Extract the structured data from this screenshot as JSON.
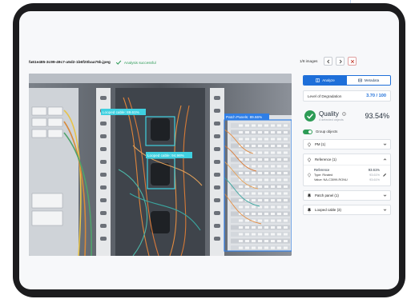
{
  "header": {
    "filename": "fa61e485-3c99-49c7-a5d2-1b6f20baa75b.jpeg",
    "status": "Analysis successful",
    "image_count": "1/8 images"
  },
  "detections": [
    {
      "label": "Looped cable: 89.61%"
    },
    {
      "label": "Looped cable: 94.96%"
    },
    {
      "label": "Patch Panels: 89.66%"
    }
  ],
  "panel": {
    "tabs": [
      {
        "label": "Analyze",
        "icon": "columns-icon",
        "active": true
      },
      {
        "label": "Metadata",
        "icon": "card-icon",
        "active": false
      }
    ],
    "degradation": {
      "label": "Level of Degradation",
      "value": "3.70 / 100"
    },
    "quality": {
      "label": "Quality",
      "sub": "4 detected objects",
      "percent": "93.54%"
    },
    "group_objects": {
      "label": "Group objects",
      "enabled": true
    },
    "accordions": [
      {
        "label": "PM (1)",
        "icon": "tag-icon",
        "expanded": false
      },
      {
        "label": "Reference (1)",
        "icon": "tag-icon",
        "expanded": true
      },
      {
        "label": "Patch panel (1)",
        "icon": "pin-icon",
        "expanded": false
      },
      {
        "label": "Looped cable (3)",
        "icon": "pin-icon",
        "expanded": false
      }
    ],
    "reference_item": {
      "name": "Reference",
      "score": "93.61%",
      "type_label": "Type: Rivated",
      "type_score": "93.61%",
      "value_label": "Value: NA-C3099-RONU",
      "value_score": "93.61%"
    }
  },
  "colors": {
    "accent": "#1e6fd9",
    "success": "#2d9b56",
    "bbox": "#3fd0e0"
  }
}
